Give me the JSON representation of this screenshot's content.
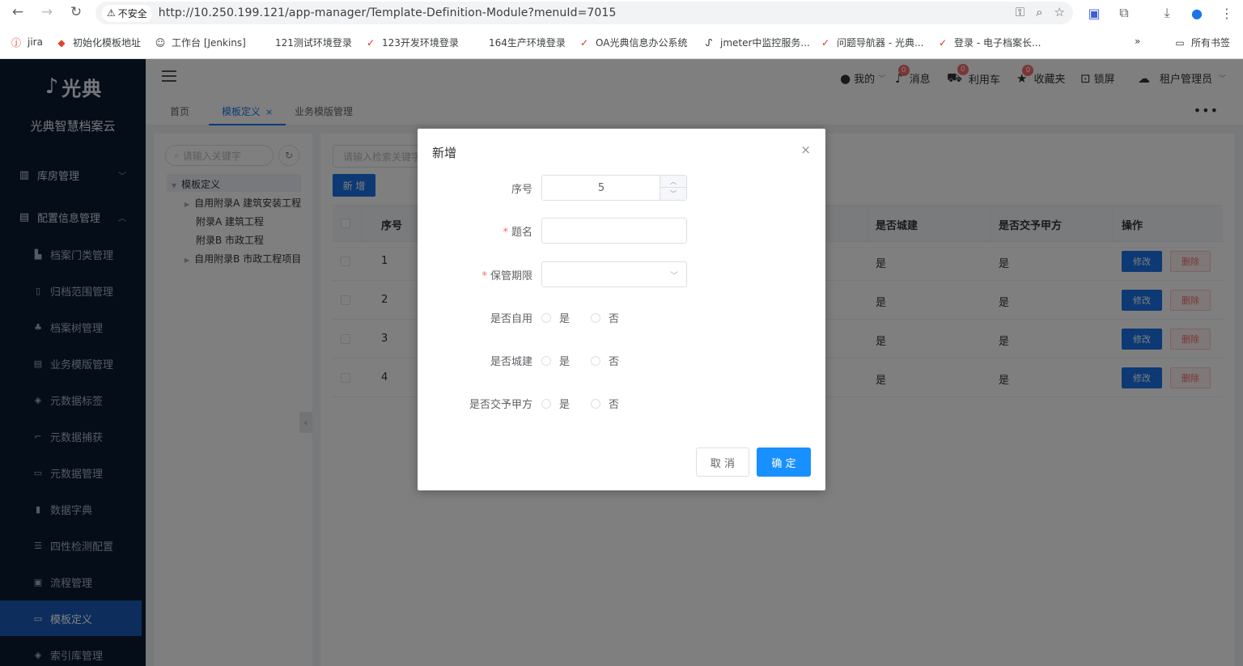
{
  "browser": {
    "security_label": "不安全",
    "url": "http://10.250.199.121/app-manager/Template-Definition-Module?menuId=7015",
    "bookmarks": [
      {
        "label": "jira",
        "icon": "jira-icon"
      },
      {
        "label": "初始化模板地址",
        "icon": "gitlab-icon"
      },
      {
        "label": "工作台 [Jenkins]",
        "icon": "jenkins-icon"
      },
      {
        "label": "121测试环境登录",
        "icon": "page-icon"
      },
      {
        "label": "123开发环境登录",
        "icon": "app-icon"
      },
      {
        "label": "164生产环境登录",
        "icon": "page-icon"
      },
      {
        "label": "OA光典信息办公系统",
        "icon": "oa-icon"
      },
      {
        "label": "jmeter中监控服务...",
        "icon": "jmeter-icon"
      },
      {
        "label": "问题导航器 - 光典...",
        "icon": "app-icon"
      },
      {
        "label": "登录 - 电子档案长...",
        "icon": "app-icon"
      }
    ],
    "all_bookmarks": "所有书签"
  },
  "sidebar": {
    "logo_text": "光典",
    "brand": "光典智慧档案云",
    "groups": [
      {
        "label": "库房管理",
        "icon": "warehouse-icon",
        "expanded": false
      },
      {
        "label": "配置信息管理",
        "icon": "config-icon",
        "expanded": true
      }
    ],
    "items": [
      {
        "label": "档案门类管理",
        "icon": "category-icon"
      },
      {
        "label": "归档范围管理",
        "icon": "file-icon"
      },
      {
        "label": "档案树管理",
        "icon": "tree-icon"
      },
      {
        "label": "业务模版管理",
        "icon": "template-icon"
      },
      {
        "label": "元数据标签",
        "icon": "tag-icon"
      },
      {
        "label": "元数据捕获",
        "icon": "crop-icon"
      },
      {
        "label": "元数据管理",
        "icon": "card-icon"
      },
      {
        "label": "数据字典",
        "icon": "book-icon"
      },
      {
        "label": "四性检测配置",
        "icon": "sliders-icon"
      },
      {
        "label": "流程管理",
        "icon": "flow-icon"
      },
      {
        "label": "模板定义",
        "icon": "window-icon",
        "active": true
      },
      {
        "label": "索引库管理",
        "icon": "layers-icon"
      }
    ]
  },
  "header": {
    "my": "我的",
    "messages": "消息",
    "messages_count": "0",
    "cart": "利用车",
    "cart_count": "0",
    "favorites": "收藏夹",
    "favorites_count": "0",
    "lock": "锁屏",
    "user": "租户管理员"
  },
  "tabs": [
    {
      "label": "首页",
      "active": false
    },
    {
      "label": "模板定义",
      "active": true,
      "closable": "×"
    },
    {
      "label": "业务模版管理",
      "active": false
    }
  ],
  "tree": {
    "search_placeholder": "请输入关键字",
    "root": "模板定义",
    "children": [
      "自用附录A 建筑安装工程",
      "附录A 建筑工程",
      "附录B 市政工程",
      "自用附录B 市政工程项目"
    ]
  },
  "table": {
    "search_placeholder": "请输入检索关键字",
    "new_button": "新 增",
    "headers": {
      "index": "序号",
      "is_city": "是否城建",
      "is_party_a": "是否交予甲方",
      "ops": "操作"
    },
    "rows": [
      {
        "index": "1",
        "is_city": "是",
        "is_party_a": "是"
      },
      {
        "index": "2",
        "is_city": "是",
        "is_party_a": "是"
      },
      {
        "index": "3",
        "is_city": "是",
        "is_party_a": "是"
      },
      {
        "index": "4",
        "is_city": "是",
        "is_party_a": "是"
      }
    ],
    "edit_label": "修改",
    "delete_label": "删除"
  },
  "modal": {
    "title": "新增",
    "close": "×",
    "fields": {
      "index_label": "序号",
      "index_value": "5",
      "title_label": "题名",
      "retention_label": "保管期限",
      "self_use_label": "是否自用",
      "city_label": "是否城建",
      "party_a_label": "是否交予甲方"
    },
    "yes": "是",
    "no": "否",
    "cancel": "取 消",
    "confirm": "确 定"
  },
  "colors": {
    "primary": "#1a73e8",
    "sidebar_bg": "#0b1a33",
    "active_menu": "#1a5cb8",
    "danger": "#f56c6c"
  }
}
